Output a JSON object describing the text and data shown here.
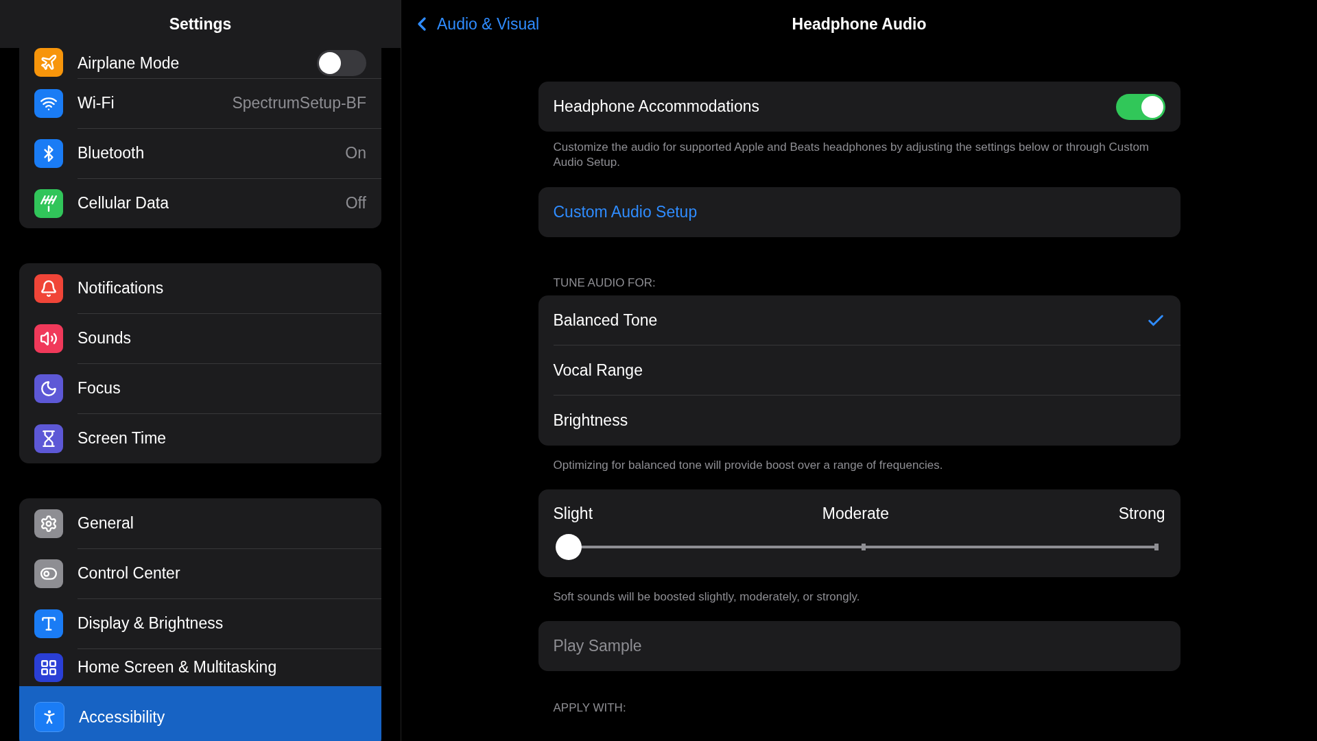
{
  "sidebar": {
    "title": "Settings",
    "groups": [
      {
        "items": [
          {
            "label": "Airplane Mode",
            "color": "#f7950b",
            "toggle": {
              "on": false
            },
            "selected": false
          },
          {
            "label": "Wi-Fi",
            "value": "SpectrumSetup-BF",
            "color": "#1a7cf5",
            "selected": false
          },
          {
            "label": "Bluetooth",
            "value": "On",
            "color": "#1a7cf5",
            "selected": false
          },
          {
            "label": "Cellular Data",
            "value": "Off",
            "color": "#31c55a",
            "selected": false
          }
        ]
      },
      {
        "items": [
          {
            "label": "Notifications",
            "color": "#f04538",
            "selected": false
          },
          {
            "label": "Sounds",
            "color": "#f0395a",
            "selected": false
          },
          {
            "label": "Focus",
            "color": "#5d58d6",
            "selected": false
          },
          {
            "label": "Screen Time",
            "color": "#5d58d6",
            "selected": false
          }
        ]
      },
      {
        "items": [
          {
            "label": "General",
            "color": "#8e8e93",
            "selected": false
          },
          {
            "label": "Control Center",
            "color": "#8e8e93",
            "selected": false
          },
          {
            "label": "Display & Brightness",
            "color": "#1a7cf5",
            "selected": false
          },
          {
            "label": "Home Screen & Multitasking",
            "color": "#2a3fd6",
            "selected": false
          },
          {
            "label": "Accessibility",
            "color": "#1a7cf5",
            "selected": true
          }
        ]
      }
    ]
  },
  "nav": {
    "back": "Audio & Visual",
    "title": "Headphone Audio"
  },
  "accommodations": {
    "label": "Headphone Accommodations",
    "on": true,
    "footer": "Customize the audio for supported Apple and Beats headphones by adjusting the settings below or through Custom Audio Setup."
  },
  "custom_setup": {
    "label": "Custom Audio Setup"
  },
  "tune": {
    "header": "TUNE AUDIO FOR:",
    "options": [
      {
        "label": "Balanced Tone",
        "selected": true
      },
      {
        "label": "Vocal Range",
        "selected": false
      },
      {
        "label": "Brightness",
        "selected": false
      }
    ],
    "footer": "Optimizing for balanced tone will provide boost over a range of frequencies."
  },
  "boost": {
    "labels": [
      "Slight",
      "Moderate",
      "Strong"
    ],
    "level": 0,
    "footer": "Soft sounds will be boosted slightly, moderately, or strongly."
  },
  "play_sample": {
    "label": "Play Sample",
    "disabled": true
  },
  "apply": {
    "header": "APPLY WITH:"
  }
}
